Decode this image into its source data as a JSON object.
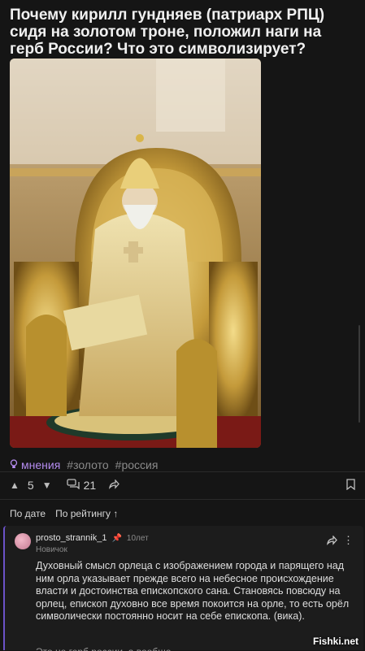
{
  "post": {
    "title": "Почему кирилл гундняев (патриарх РПЦ) сидя на золотом троне, положил наги на герб России? Что это символизирует?",
    "tags": [
      "мнения",
      "#золото",
      "#россия"
    ],
    "votes": "5",
    "comments": "21"
  },
  "sort": {
    "by_date": "По дате",
    "by_rating": "По рейтингу ↑"
  },
  "comment": {
    "author": "prosto_strannik_1",
    "age": "10лет",
    "rank": "Новичок",
    "text": "Духовный смысл орлеца с изображением города и парящего над ним орла указывает прежде всего на небесное происхождение власти и достоинства епископского сана. Становясь повсюду на орлец, епископ духовно все время покоится на орле, то есть орёл символически постоянно носит на себе епископа. (вика).",
    "next_text": "Это не герб россии, а вообще"
  },
  "watermark": "Fishki.net",
  "icons": {
    "tag": "lightbulb-icon",
    "upvote": "arrow-up-icon",
    "downvote": "arrow-down-icon",
    "comments": "comments-icon",
    "share": "share-icon",
    "bookmark": "bookmark-icon",
    "pin": "pin-icon",
    "more": "more-icon"
  },
  "colors": {
    "background": "#151515",
    "accent": "#6b52c8",
    "tag": "#b58cf0"
  }
}
